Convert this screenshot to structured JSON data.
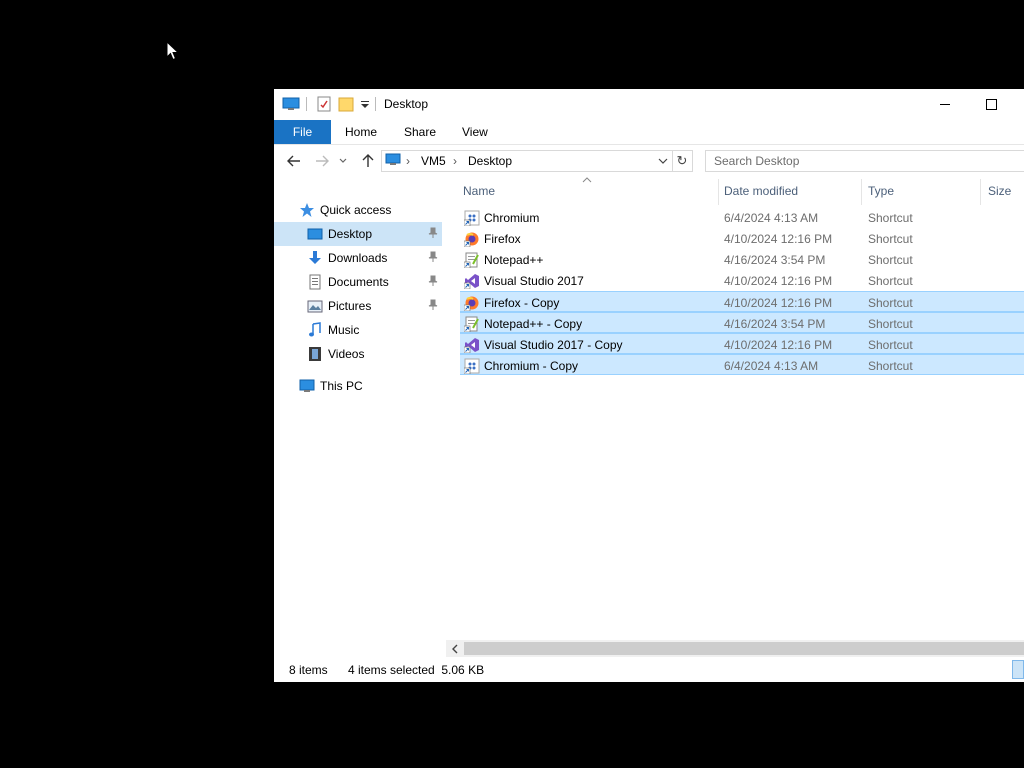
{
  "window": {
    "title": "Desktop",
    "minimize_icon": "minimize-icon",
    "maximize_icon": "maximize-icon"
  },
  "ribbon": {
    "tabs": [
      "File",
      "Home",
      "Share",
      "View"
    ]
  },
  "address": {
    "crumbs": [
      "VM5",
      "Desktop"
    ]
  },
  "search": {
    "placeholder": "Search Desktop"
  },
  "nav": {
    "quick_access": "Quick access",
    "items": [
      {
        "label": "Desktop",
        "icon": "desktop-folder-icon",
        "pinned": true,
        "selected": true
      },
      {
        "label": "Downloads",
        "icon": "downloads-folder-icon",
        "pinned": true
      },
      {
        "label": "Documents",
        "icon": "documents-folder-icon",
        "pinned": true
      },
      {
        "label": "Pictures",
        "icon": "pictures-folder-icon",
        "pinned": true
      },
      {
        "label": "Music",
        "icon": "music-folder-icon",
        "pinned": false
      },
      {
        "label": "Videos",
        "icon": "videos-folder-icon",
        "pinned": false
      }
    ],
    "this_pc": "This PC"
  },
  "columns": [
    "Name",
    "Date modified",
    "Type",
    "Size"
  ],
  "files": [
    {
      "name": "Chromium",
      "date": "6/4/2024 4:13 AM",
      "type": "Shortcut",
      "icon": "chromium-icon",
      "selected": false
    },
    {
      "name": "Firefox",
      "date": "4/10/2024 12:16 PM",
      "type": "Shortcut",
      "icon": "firefox-icon",
      "selected": false
    },
    {
      "name": "Notepad++",
      "date": "4/16/2024 3:54 PM",
      "type": "Shortcut",
      "icon": "notepadpp-icon",
      "selected": false
    },
    {
      "name": "Visual Studio 2017",
      "date": "4/10/2024 12:16 PM",
      "type": "Shortcut",
      "icon": "visual-studio-icon",
      "selected": false
    },
    {
      "name": "Firefox - Copy",
      "date": "4/10/2024 12:16 PM",
      "type": "Shortcut",
      "icon": "firefox-icon",
      "selected": true
    },
    {
      "name": "Notepad++ - Copy",
      "date": "4/16/2024 3:54 PM",
      "type": "Shortcut",
      "icon": "notepadpp-icon",
      "selected": true
    },
    {
      "name": "Visual Studio 2017 - Copy",
      "date": "4/10/2024 12:16 PM",
      "type": "Shortcut",
      "icon": "visual-studio-icon",
      "selected": true
    },
    {
      "name": "Chromium - Copy",
      "date": "6/4/2024 4:13 AM",
      "type": "Shortcut",
      "icon": "chromium-icon",
      "selected": true
    }
  ],
  "status": {
    "item_count": "8 items",
    "selection": "4 items selected  5.06 KB"
  },
  "colors": {
    "accent": "#1a73c4",
    "selection_bg": "#cce8ff",
    "selection_border": "#99d1ff"
  }
}
